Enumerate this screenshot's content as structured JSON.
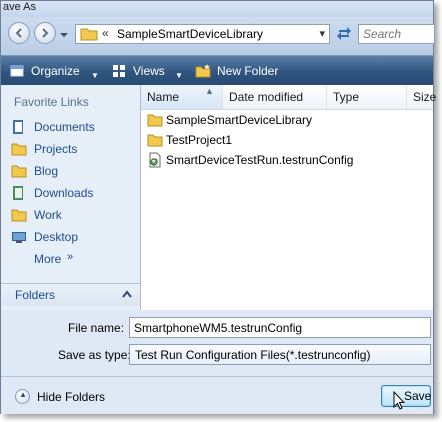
{
  "window": {
    "title": "ave As"
  },
  "nav": {
    "address_chevron": "«",
    "address_path": "SampleSmartDeviceLibrary",
    "search_placeholder": "Search",
    "back_icon": "back-arrow-icon",
    "forward_icon": "forward-arrow-icon"
  },
  "toolbar": {
    "organize": "Organize",
    "views": "Views",
    "new_folder": "New Folder"
  },
  "sidebar": {
    "header": "Favorite Links",
    "items": [
      {
        "label": "Documents",
        "icon": "documents-icon"
      },
      {
        "label": "Projects",
        "icon": "folder-icon"
      },
      {
        "label": "Blog",
        "icon": "folder-icon"
      },
      {
        "label": "Downloads",
        "icon": "downloads-icon"
      },
      {
        "label": "Work",
        "icon": "folder-icon"
      },
      {
        "label": "Desktop",
        "icon": "desktop-icon"
      },
      {
        "label": "More",
        "icon": ""
      }
    ],
    "more_arrow": "»",
    "folders_label": "Folders"
  },
  "file_list": {
    "columns": [
      "Name",
      "Date modified",
      "Type",
      "Size"
    ],
    "sorted_column": "Name",
    "rows": [
      {
        "name": "SampleSmartDeviceLibrary",
        "icon": "folder-icon"
      },
      {
        "name": "TestProject1",
        "icon": "folder-icon"
      },
      {
        "name": "SmartDeviceTestRun.testrunConfig",
        "icon": "config-file-icon"
      }
    ]
  },
  "form": {
    "file_name_label": "File name:",
    "file_name_value": "SmartphoneWM5.testrunConfig",
    "save_type_label": "Save as type:",
    "save_type_value": "Test Run Configuration Files(*.testrunconfig)"
  },
  "footer": {
    "hide_folders": "Hide Folders",
    "save_button": "Save"
  },
  "colors": {
    "command_bar": "#2f5580",
    "link_text": "#1e4e8c",
    "window_bg": "#dfe9f5"
  }
}
